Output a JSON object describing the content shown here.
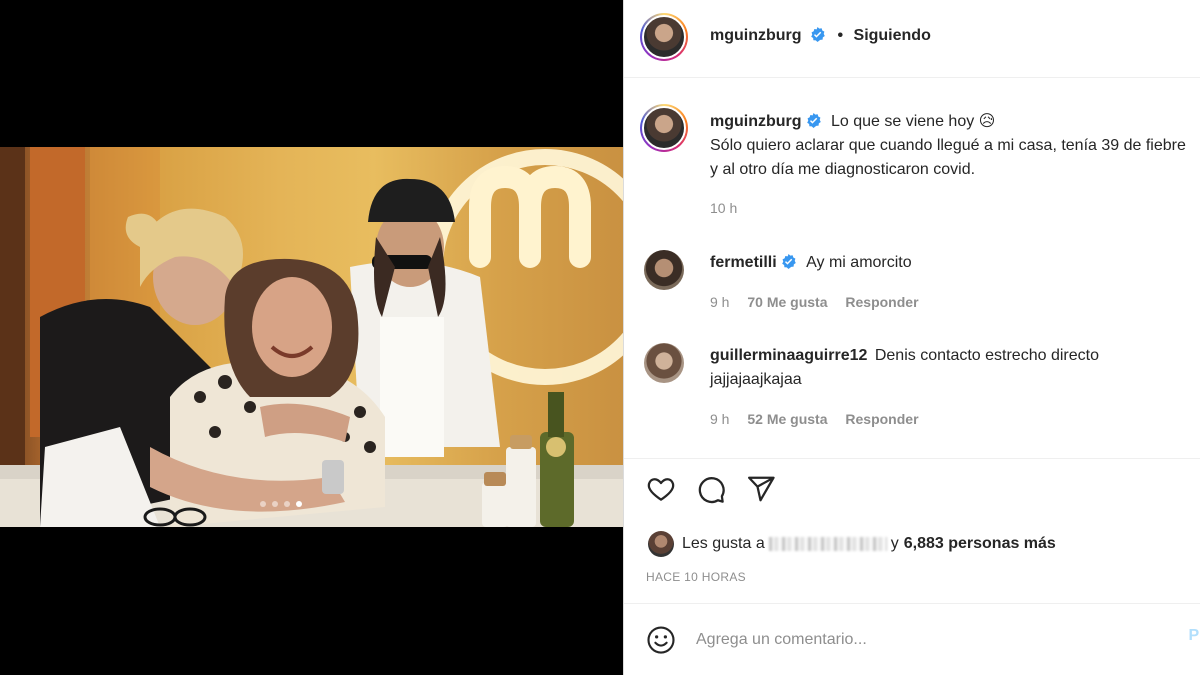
{
  "post": {
    "author": "mguinzburg",
    "follow_separator": "•",
    "follow_status": "Siguiendo",
    "caption_line1": "Lo que se viene hoy 😥",
    "caption_line2": "Sólo quiero aclarar que cuando llegué a mi casa, tenía 39 de fiebre",
    "caption_line3": "y al otro día me diagnosticaron covid.",
    "caption_time": "10 h"
  },
  "comments": [
    {
      "user": "fermetilli",
      "text": "Ay mi amorcito",
      "text_line2": "",
      "time": "9 h",
      "likes": "70 Me gusta",
      "reply": "Responder"
    },
    {
      "user": "guillerminaaguirre12",
      "text": "Denis contacto estrecho directo",
      "text_line2": "jajjajaajkajaa",
      "time": "9 h",
      "likes": "52 Me gusta",
      "reply": "Responder"
    }
  ],
  "likes_bar": {
    "prefix": "Les gusta a",
    "suffix": "y",
    "count_text": "6,883 personas más"
  },
  "time_ago": "HACE 10 HORAS",
  "comment_box": {
    "placeholder": "Agrega un comentario...",
    "post_label": "Pu"
  },
  "carousel": {
    "slides": 4,
    "active_index": 3
  },
  "icons": {
    "verified": "verified-badge-icon",
    "like": "heart-icon",
    "comment": "comment-bubble-icon",
    "share": "paper-plane-icon",
    "emoji": "emoji-smile-icon"
  },
  "colors": {
    "verified_blue": "#3897f0",
    "muted_text": "#8e8e8e",
    "post_button_disabled": "#b2dffc"
  }
}
